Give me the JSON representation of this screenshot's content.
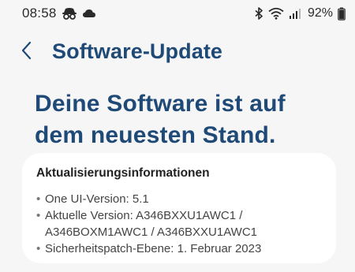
{
  "status_bar": {
    "time": "08:58",
    "left_icons": [
      "incognito-icon",
      "cloud-icon"
    ],
    "right_icons": [
      "bluetooth-icon",
      "wifi-icon",
      "signal-icon",
      "battery-icon"
    ],
    "battery_percent": "92%"
  },
  "header": {
    "back_icon": "chevron-left-icon",
    "title": "Software-Update"
  },
  "status": {
    "headline_line1": "Deine Software ist auf",
    "headline_line2": "dem neuesten Stand."
  },
  "info_card": {
    "title": "Aktualisierungsinformationen",
    "items": [
      {
        "bullet": "•",
        "line1": "One UI-Version: 5.1"
      },
      {
        "bullet": "•",
        "line1": "Aktuelle Version: A346BXXU1AWC1 /",
        "line2": "A346BOXM1AWC1 / A346BXXU1AWC1"
      },
      {
        "bullet": "•",
        "line1": "Sicherheitspatch-Ebene: 1. Februar 2023"
      }
    ]
  },
  "colors": {
    "background": "#f6f6f6",
    "accent_title": "#1f4976",
    "card": "#ffffff",
    "text_secondary": "#444444"
  }
}
